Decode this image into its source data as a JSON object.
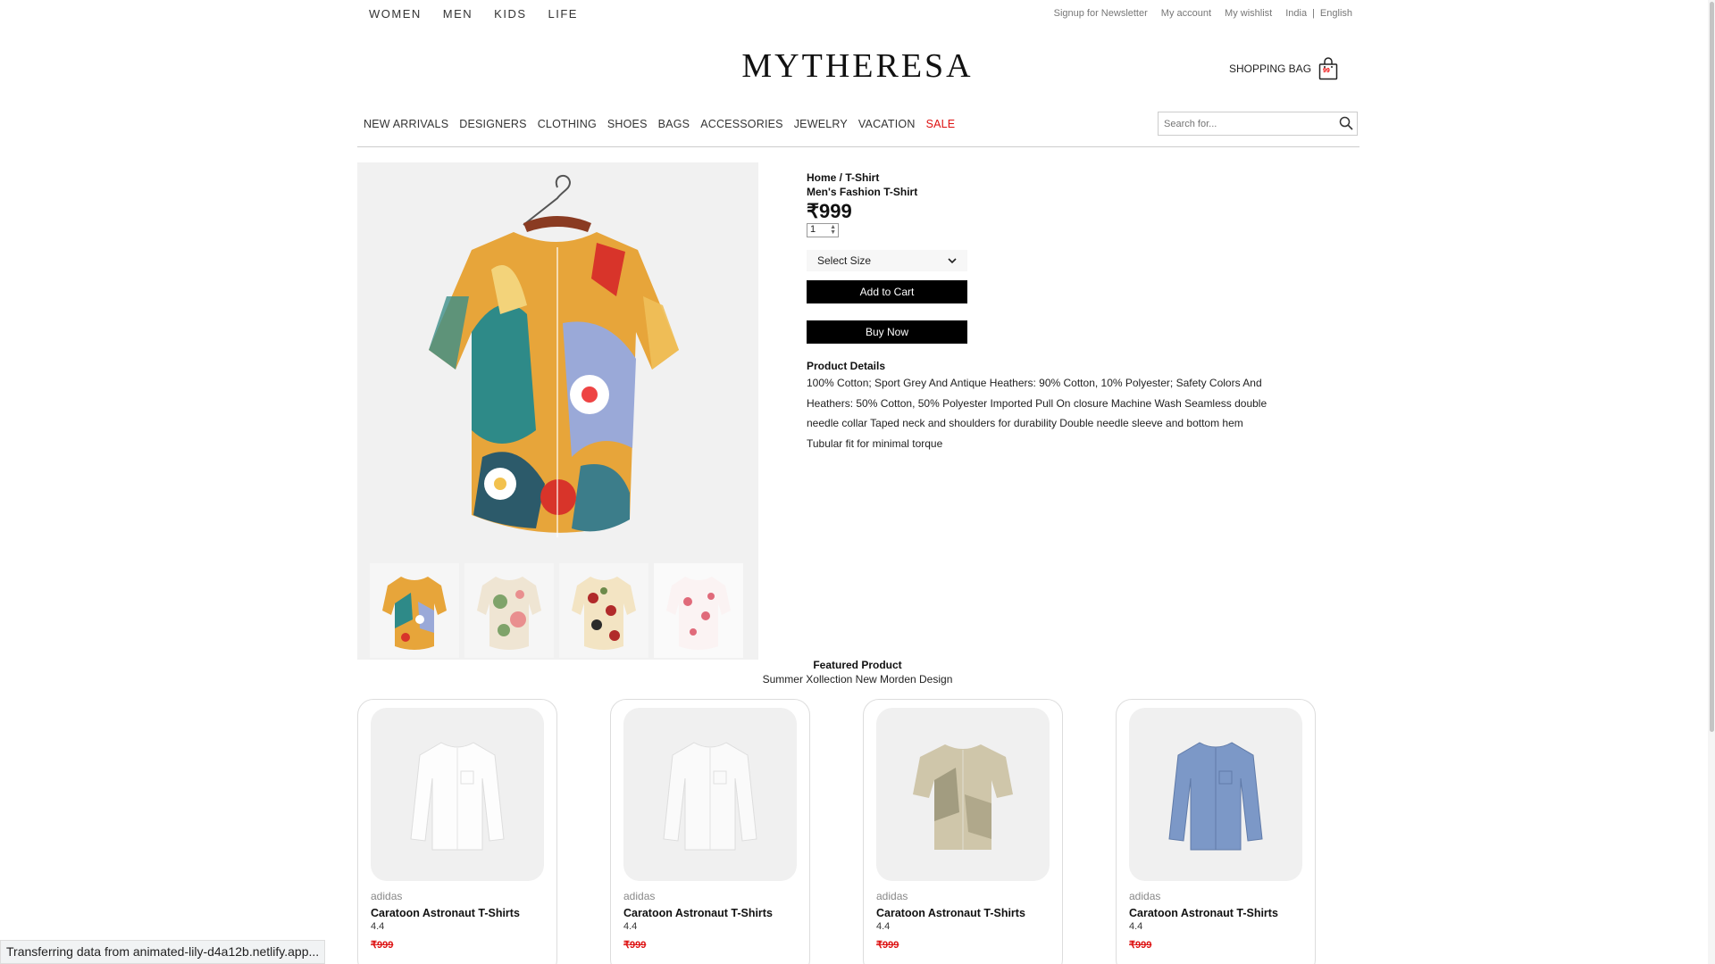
{
  "topnav": {
    "items": [
      "WOMEN",
      "MEN",
      "KIDS",
      "LIFE"
    ]
  },
  "toplinks": {
    "newsletter": "Signup for Newsletter",
    "account": "My account",
    "wishlist": "My wishlist",
    "region": "India",
    "sep": "|",
    "language": "English"
  },
  "logo": "MYTHERESA",
  "bag": {
    "label": "SHOPPING BAG",
    "count": "99"
  },
  "catnav": {
    "items": [
      "NEW ARRIVALS",
      "DESIGNERS",
      "CLOTHING",
      "SHOES",
      "BAGS",
      "ACCESSORIES",
      "JEWELRY",
      "VACATION"
    ],
    "sale": "SALE"
  },
  "search": {
    "placeholder": "Search for..."
  },
  "product": {
    "breadcrumb": "Home / T-Shirt",
    "name": "Men's Fashion T-Shirt",
    "price": "₹999",
    "quantity": "1",
    "size_select": "Select Size",
    "add_to_cart": "Add to Cart",
    "buy_now": "Buy Now",
    "details_title": "Product Details",
    "details_text": "100% Cotton; Sport Grey And Antique Heathers: 90% Cotton, 10% Polyester; Safety Colors And Heathers: 50% Cotton, 50% Polyester Imported Pull On closure Machine Wash Seamless double needle collar Taped neck and shoulders for durability Double needle sleeve and bottom hem Tubular fit for minimal torque"
  },
  "featured": {
    "title": "Featured Product",
    "subtitle": "Summer Xollection New Morden Design",
    "cards": [
      {
        "brand": "adidas",
        "name": "Caratoon Astronaut T-Shirts",
        "rating": "4.4",
        "price": "₹999"
      },
      {
        "brand": "adidas",
        "name": "Caratoon Astronaut T-Shirts",
        "rating": "4.4",
        "price": "₹999"
      },
      {
        "brand": "adidas",
        "name": "Caratoon Astronaut T-Shirts",
        "rating": "4.4",
        "price": "₹999"
      },
      {
        "brand": "adidas",
        "name": "Caratoon Astronaut T-Shirts",
        "rating": "4.4",
        "price": "₹999"
      }
    ]
  },
  "status": "Transferring data from animated-lily-d4a12b.netlify.app..."
}
